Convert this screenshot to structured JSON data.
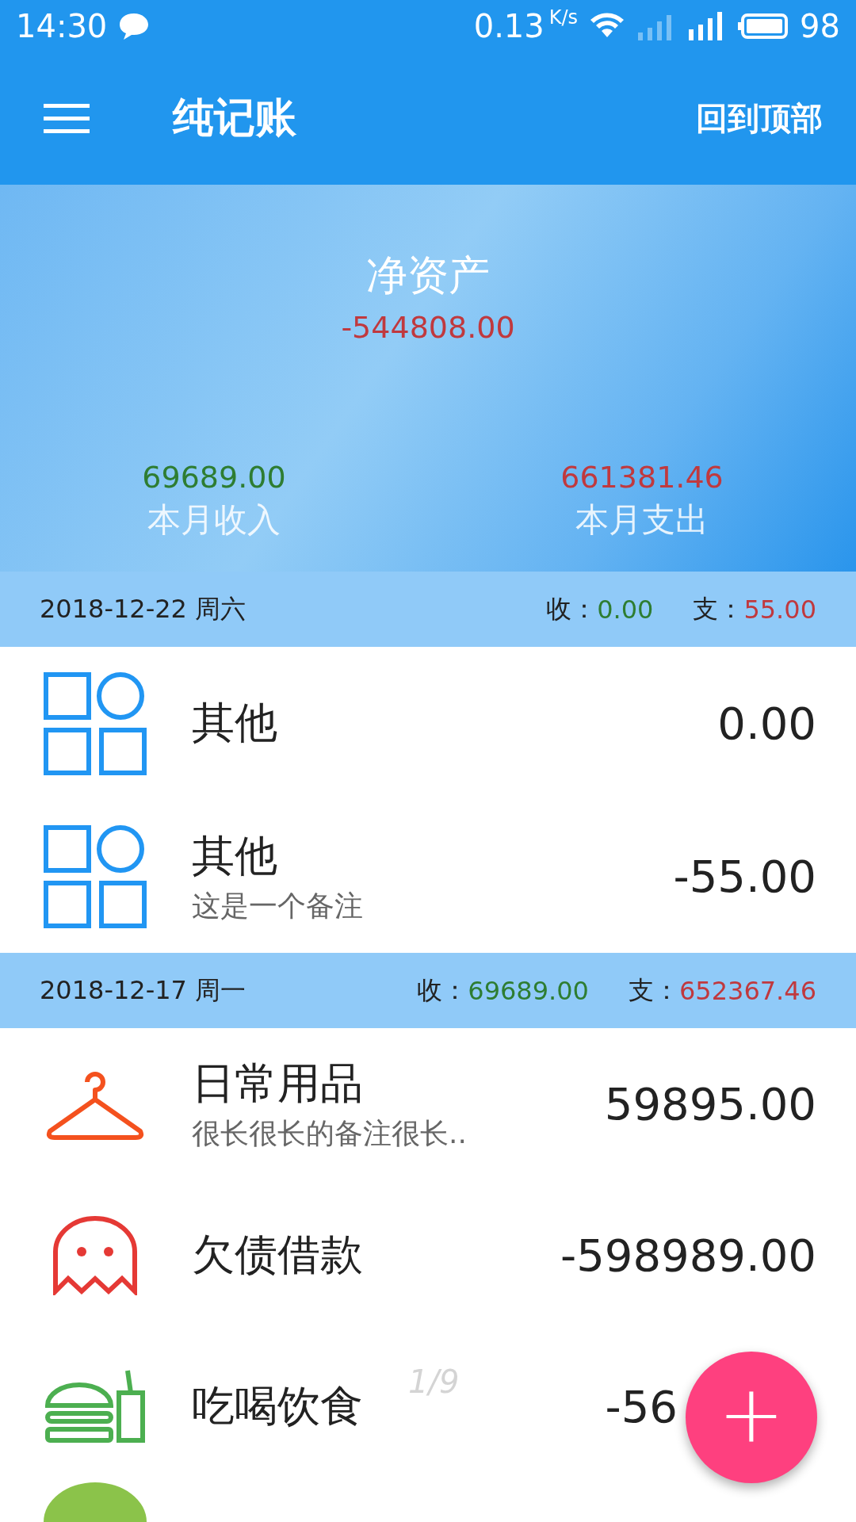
{
  "status_bar": {
    "time": "14:30",
    "speed": "0.13",
    "speed_unit": "K/s",
    "battery": "98"
  },
  "app_bar": {
    "title": "纯记账",
    "action": "回到顶部"
  },
  "summary": {
    "title": "净资产",
    "net": "-544808.00",
    "income": "69689.00",
    "income_label": "本月收入",
    "expense": "661381.46",
    "expense_label": "本月支出"
  },
  "days": [
    {
      "date": "2018-12-22 周六",
      "income_label": "收：",
      "income": "0.00",
      "expense_label": "支：",
      "expense": "55.00",
      "entries": [
        {
          "kind": "grid",
          "color": "#2196f3",
          "category": "其他",
          "amount": "0.00"
        },
        {
          "kind": "grid",
          "color": "#2196f3",
          "category": "其他",
          "note": "这是一个备注",
          "amount": "-55.00"
        }
      ]
    },
    {
      "date": "2018-12-17 周一",
      "income_label": "收：",
      "income": "69689.00",
      "expense_label": "支：",
      "expense": "652367.46",
      "entries": [
        {
          "kind": "hanger",
          "color": "#f4511e",
          "category": "日常用品",
          "note": "很长很长的备注很长..",
          "amount": "59895.00"
        },
        {
          "kind": "ghost",
          "color": "#e53935",
          "category": "欠债借款",
          "amount": "-598989.00"
        },
        {
          "kind": "burger",
          "color": "#4caf50",
          "category": "吃喝饮食",
          "amount": "-56",
          "covered": true
        },
        {
          "kind": "circle",
          "color": "#8bc34a"
        }
      ]
    }
  ],
  "page_indicator": "1/9",
  "fab": {
    "symbol": "+"
  }
}
